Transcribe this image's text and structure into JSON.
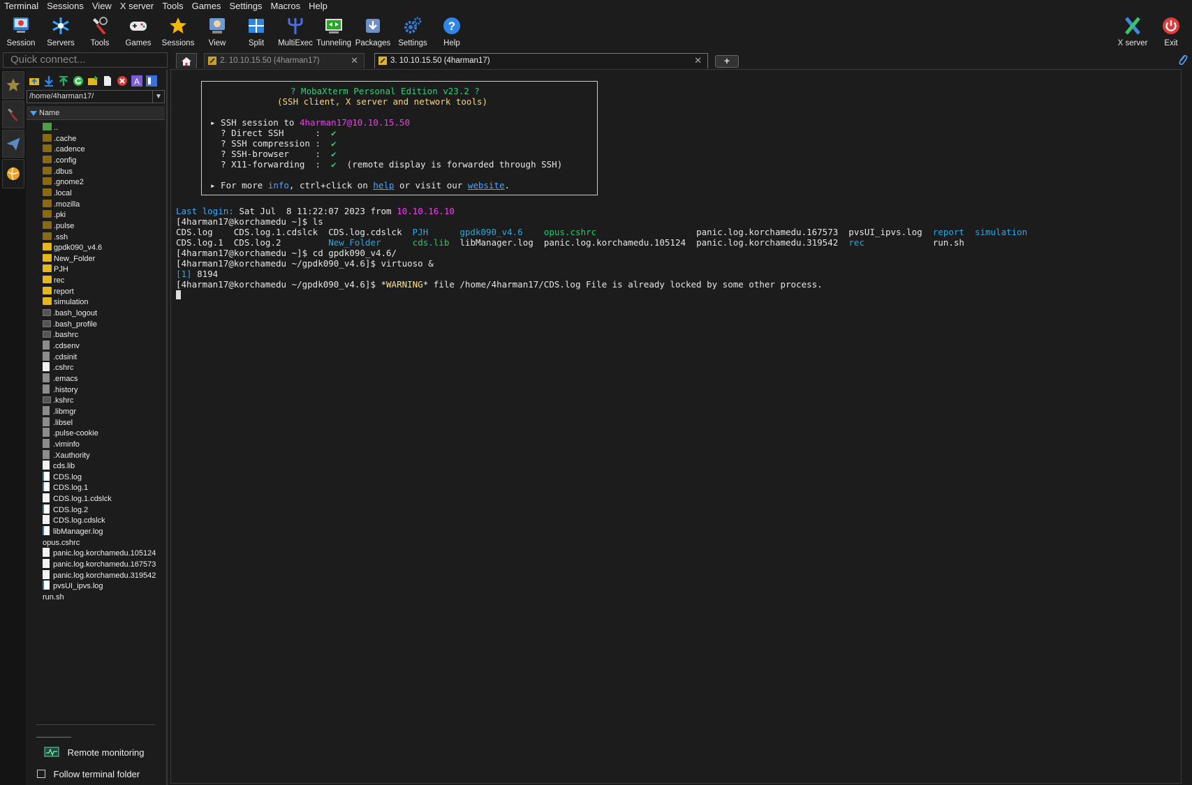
{
  "menu": [
    "Terminal",
    "Sessions",
    "View",
    "X server",
    "Tools",
    "Games",
    "Settings",
    "Macros",
    "Help"
  ],
  "toolbar": {
    "buttons": [
      "Session",
      "Servers",
      "Tools",
      "Games",
      "Sessions",
      "View",
      "Split",
      "MultiExec",
      "Tunneling",
      "Packages",
      "Settings",
      "Help"
    ],
    "right_buttons": [
      "X server",
      "Exit"
    ]
  },
  "quick_connect": {
    "placeholder": "Quick connect..."
  },
  "tabs": [
    {
      "label": "2. 10.10.15.50 (4harman17)"
    },
    {
      "label": "3. 10.10.15.50 (4harman17)"
    }
  ],
  "newtab_label": "+",
  "sidebar": {
    "path": "/home/4harman17/",
    "header": "Name",
    "files": [
      {
        "name": "..",
        "type": "up"
      },
      {
        "name": ".cache",
        "type": "folder"
      },
      {
        "name": ".cadence",
        "type": "folder"
      },
      {
        "name": ".config",
        "type": "folder"
      },
      {
        "name": ".dbus",
        "type": "folder"
      },
      {
        "name": ".gnome2",
        "type": "folder"
      },
      {
        "name": ".local",
        "type": "folder"
      },
      {
        "name": ".mozilla",
        "type": "folder"
      },
      {
        "name": ".pki",
        "type": "folder"
      },
      {
        "name": ".pulse",
        "type": "folder"
      },
      {
        "name": ".ssh",
        "type": "folder"
      },
      {
        "name": "gpdk090_v4.6",
        "type": "folderb"
      },
      {
        "name": "New_Folder",
        "type": "folderb"
      },
      {
        "name": "PJH",
        "type": "folderb"
      },
      {
        "name": "rec",
        "type": "folderb"
      },
      {
        "name": "report",
        "type": "folderb"
      },
      {
        "name": "simulation",
        "type": "folderb"
      },
      {
        "name": ".bash_logout",
        "type": "dfile"
      },
      {
        "name": ".bash_profile",
        "type": "dfile"
      },
      {
        "name": ".bashrc",
        "type": "dfile"
      },
      {
        "name": ".cdsenv",
        "type": "gfile"
      },
      {
        "name": ".cdsinit",
        "type": "gfile"
      },
      {
        "name": ".cshrc",
        "type": "file"
      },
      {
        "name": ".emacs",
        "type": "gfile"
      },
      {
        "name": ".history",
        "type": "gfile"
      },
      {
        "name": ".kshrc",
        "type": "dfile"
      },
      {
        "name": ".libmgr",
        "type": "gfile"
      },
      {
        "name": ".libsel",
        "type": "gfile"
      },
      {
        "name": ".pulse-cookie",
        "type": "gfile"
      },
      {
        "name": ".viminfo",
        "type": "gfile"
      },
      {
        "name": ".Xauthority",
        "type": "gfile"
      },
      {
        "name": "cds.lib",
        "type": "file"
      },
      {
        "name": "CDS.log",
        "type": "doc"
      },
      {
        "name": "CDS.log.1",
        "type": "doc"
      },
      {
        "name": "CDS.log.1.cdslck",
        "type": "file"
      },
      {
        "name": "CDS.log.2",
        "type": "doc"
      },
      {
        "name": "CDS.log.cdslck",
        "type": "file"
      },
      {
        "name": "libManager.log",
        "type": "doc"
      },
      {
        "name": "opus.cshrc",
        "type": "term"
      },
      {
        "name": "panic.log.korchamedu.105124",
        "type": "file"
      },
      {
        "name": "panic.log.korchamedu.167573",
        "type": "file"
      },
      {
        "name": "panic.log.korchamedu.319542",
        "type": "file"
      },
      {
        "name": "pvsUI_ipvs.log",
        "type": "doc"
      },
      {
        "name": "run.sh",
        "type": "term"
      }
    ],
    "remote_monitoring": "Remote monitoring",
    "follow_terminal_folder": "Follow terminal folder"
  },
  "terminal": {
    "banner": {
      "title": "? MobaXterm Personal Edition v23.2 ?",
      "subtitle": "(SSH client, X server and network tools)",
      "session_prefix": "▸ SSH session to ",
      "session_target": "4harman17@10.10.15.50",
      "features": [
        {
          "label": "  ? Direct SSH      :  ",
          "check": "✔",
          "extra": ""
        },
        {
          "label": "  ? SSH compression :  ",
          "check": "✔",
          "extra": ""
        },
        {
          "label": "  ? SSH-browser     :  ",
          "check": "✔",
          "extra": ""
        },
        {
          "label": "  ? X11-forwarding  :  ",
          "check": "✔",
          "extra": "  (remote display is forwarded through SSH)"
        }
      ],
      "more_prefix": "▸ For more ",
      "more_info": "info",
      "more_mid": ", ctrl+click on ",
      "more_help": "help",
      "more_mid2": " or visit our ",
      "more_website": "website",
      "more_end": "."
    },
    "last_login_label": "Last login:",
    "last_login_text": " Sat Jul  8 11:22:07 2023 from ",
    "last_login_ip": "10.10.16.10",
    "prompt1": "[4harman17@korchamedu ~]$ ls",
    "ls_row1": [
      {
        "t": "CDS.log    CDS.log.1.cdslck  CDS.log.cdslck  ",
        "c": ""
      },
      {
        "t": "PJH",
        "c": "teal"
      },
      {
        "t": "      ",
        "c": ""
      },
      {
        "t": "gpdk090_v4.6",
        "c": "teal"
      },
      {
        "t": "    ",
        "c": ""
      },
      {
        "t": "opus.cshrc",
        "c": "dgreen"
      },
      {
        "t": "                   panic.log.korchamedu.167573  pvsUI_ipvs.log  ",
        "c": ""
      },
      {
        "t": "report",
        "c": "teal"
      },
      {
        "t": "  ",
        "c": ""
      },
      {
        "t": "simulation",
        "c": "teal"
      }
    ],
    "ls_row2": [
      {
        "t": "CDS.log.1  CDS.log.2         ",
        "c": ""
      },
      {
        "t": "New_Folder",
        "c": "teal"
      },
      {
        "t": "      ",
        "c": ""
      },
      {
        "t": "cds.lib",
        "c": "dgreen"
      },
      {
        "t": "  libManager.log  panic.log.korchamedu.105124  panic.log.korchamedu.319542  ",
        "c": ""
      },
      {
        "t": "rec",
        "c": "teal"
      },
      {
        "t": "             run.sh",
        "c": ""
      }
    ],
    "prompt2": "[4harman17@korchamedu ~]$ cd gpdk090_v4.6/",
    "prompt3": "[4harman17@korchamedu ~/gpdk090_v4.6]$ virtuoso &",
    "job_num": "[1]",
    "job_pid": " 8194",
    "prompt4": "[4harman17@korchamedu ~/gpdk090_v4.6]$ ",
    "warn_star1": "*",
    "warn_word": "WARNING",
    "warn_rest": "* file /home/4harman17/CDS.log File is already locked by some other process."
  }
}
